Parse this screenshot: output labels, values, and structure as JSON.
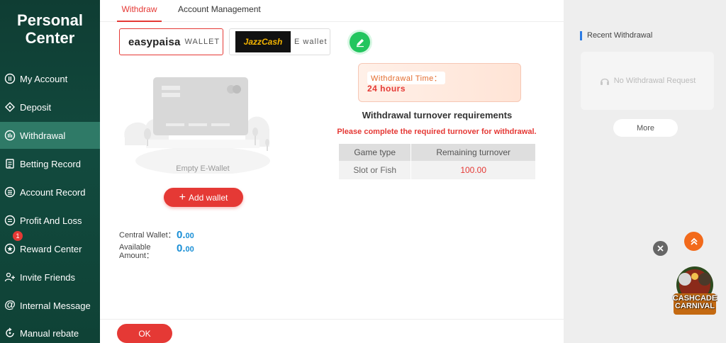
{
  "sidebar": {
    "title_line1": "Personal",
    "title_line2": "Center",
    "items": [
      {
        "label": "My Account",
        "icon": "account-icon"
      },
      {
        "label": "Deposit",
        "icon": "deposit-icon"
      },
      {
        "label": "Withdrawal",
        "icon": "withdrawal-icon"
      },
      {
        "label": "Betting Record",
        "icon": "record-icon"
      },
      {
        "label": "Account Record",
        "icon": "ledger-icon"
      },
      {
        "label": "Profit And Loss",
        "icon": "profit-icon"
      },
      {
        "label": "Reward Center",
        "icon": "reward-icon",
        "badge": "1"
      },
      {
        "label": "Invite Friends",
        "icon": "invite-icon"
      },
      {
        "label": "Internal Message",
        "icon": "at-icon"
      },
      {
        "label": "Manual rebate",
        "icon": "rebate-icon"
      }
    ],
    "active_index": 2
  },
  "tabs": [
    {
      "label": "Withdraw"
    },
    {
      "label": "Account Management"
    }
  ],
  "wallets": {
    "easypaisa_logo": "easypaisa",
    "easypaisa_label": "WALLET",
    "jazzcash_logo": "JazzCash",
    "jazzcash_label": "E wallet"
  },
  "empty_wallet": {
    "text": "Empty E-Wallet",
    "add_button": "Add wallet"
  },
  "balances": {
    "central_label": "Central Wallet：",
    "central_int": "0.",
    "central_dec": "00",
    "available_label_1": "Available",
    "available_label_2": "Amount：",
    "available_int": "0.",
    "available_dec": "00"
  },
  "withdrawal_time": {
    "label": "Withdrawal Time：",
    "value": "24 hours"
  },
  "turnover": {
    "title": "Withdrawal turnover requirements",
    "warning": "Please complete the required turnover for withdrawal.",
    "headers": [
      "Game type",
      "Remaining turnover"
    ],
    "rows": [
      {
        "game_type": "Slot or Fish",
        "remaining": "100.00"
      }
    ]
  },
  "ok_button": "OK",
  "recent": {
    "title": "Recent Withdrawal",
    "empty": "No Withdrawal Request",
    "more": "More"
  },
  "promo": {
    "line1": "CASHCADE",
    "line2": "CARNIVAL"
  },
  "colors": {
    "accent": "#e53935",
    "sidebar": "#0f3d33",
    "value_blue": "#1a8fd6",
    "edit_green": "#22c55e"
  }
}
